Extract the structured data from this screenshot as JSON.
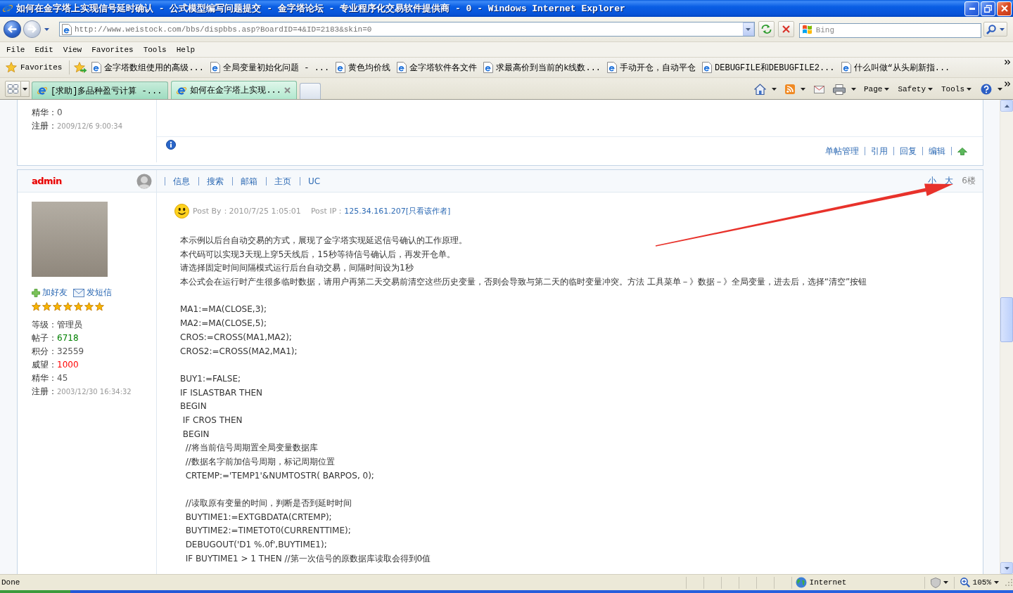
{
  "window": {
    "title": "如何在金字塔上实现信号延时确认 - 公式模型编写问题提交 - 金字塔论坛 - 专业程序化交易软件提供商 - 0 - Windows Internet Explorer"
  },
  "navigation": {
    "url": "http://www.weistock.com/bbs/dispbbs.asp?BoardID=4&ID=2183&skin=0",
    "search": {
      "placeholder": "Bing"
    }
  },
  "menu_bar": [
    "File",
    "Edit",
    "View",
    "Favorites",
    "Tools",
    "Help"
  ],
  "favorites_bar": {
    "label": "Favorites",
    "links": [
      "金字塔数组使用的高级...",
      "全局变量初始化问题 - ...",
      "黄色均价线",
      "金字塔软件各文件",
      "求最高价到当前的k线数...",
      "手动开仓，自动平仓",
      "DEBUGFILE和DEBUGFILE2...",
      "什么叫做“从头刷新指..."
    ]
  },
  "tabs": [
    {
      "label": "[求助]多品种盈亏计算 -...",
      "selected": false
    },
    {
      "label": "如何在金字塔上实现...",
      "selected": true
    }
  ],
  "command_bar": [
    "Page",
    "Safety",
    "Tools"
  ],
  "previous_post": {
    "stats": [
      {
        "label": "精华：",
        "value": "0",
        "color": "#555555",
        "kind": "text"
      },
      {
        "label": "注册：",
        "value": "2009/12/6 9:00:34",
        "color": "#999999",
        "kind": "date"
      }
    ],
    "actions": [
      "单帖管理",
      "引用",
      "回复",
      "编辑"
    ]
  },
  "post": {
    "author": "admin",
    "user_menu": [
      "信息",
      "搜索",
      "邮箱",
      "主页",
      "UC"
    ],
    "text_size": [
      "小",
      "大"
    ],
    "floor": "6楼",
    "contact": [
      {
        "label": "加好友",
        "kind": "add"
      },
      {
        "label": "发短信",
        "kind": "message"
      }
    ],
    "stars": 7,
    "stats": [
      {
        "label": "等级：",
        "value": "管理员",
        "kind": "text"
      },
      {
        "label": "帖子：",
        "value": "6718",
        "color": "#008000",
        "kind": "text"
      },
      {
        "label": "积分：",
        "value": "32559",
        "color": "#555555",
        "kind": "text"
      },
      {
        "label": "威望：",
        "value": "1000",
        "color": "#ff0000",
        "kind": "text"
      },
      {
        "label": "精华：",
        "value": "45",
        "color": "#555555",
        "kind": "text"
      },
      {
        "label": "注册：",
        "value": "2003/12/30 16:34:32",
        "color": "#999999",
        "kind": "date"
      }
    ],
    "time": "Post By：2010/7/25 1:05:01",
    "ip_label": "Post IP：",
    "ip": "125.34.161.207",
    "author_only": "[只看该作者]",
    "blocks": [
      [
        "本示例以后台自动交易的方式，展现了金字塔实现延迟信号确认的工作原理。",
        "本代码可以实现3天现上穿5天线后，15秒等待信号确认后，再发开仓单。",
        "请选择固定时间间隔模式运行后台自动交易，间隔时间设为1秒",
        "本公式会在运行时产生很多临时数据，请用户再第二天交易前清空这些历史变量，否则会导致与第二天的临时变量冲突。方法 工具菜单－》数据－》全局变量，进去后，选择“清空”按钮"
      ],
      [
        "MA1:=MA(CLOSE,3);",
        "MA2:=MA(CLOSE,5);",
        "CROS:=CROSS(MA1,MA2);",
        "CROS2:=CROSS(MA2,MA1);"
      ],
      [
        "BUY1:=FALSE;",
        "IF ISLASTBAR THEN",
        "BEGIN",
        " IF CROS THEN",
        " BEGIN",
        "  //将当前信号周期置全局变量数据库",
        "  //数据名字前加信号周期，标记周期位置",
        "  CRTEMP:='TEMP1'&NUMTOSTR( BARPOS, 0);"
      ],
      [
        "  //读取原有变量的时间，判断是否到延时时间",
        "  BUYTIME1:=EXTGBDATA(CRTEMP);",
        "  BUYTIME2:=TIMETOT0(CURRENTTIME);",
        "  DEBUGOUT('D1 %.0f',BUYTIME1);",
        "  IF BUYTIME1 > 1 THEN //第一次信号的原数据库读取会得到0值"
      ]
    ]
  },
  "status_bar": {
    "status": "Done",
    "zone": "Internet",
    "zoom": "105%"
  }
}
